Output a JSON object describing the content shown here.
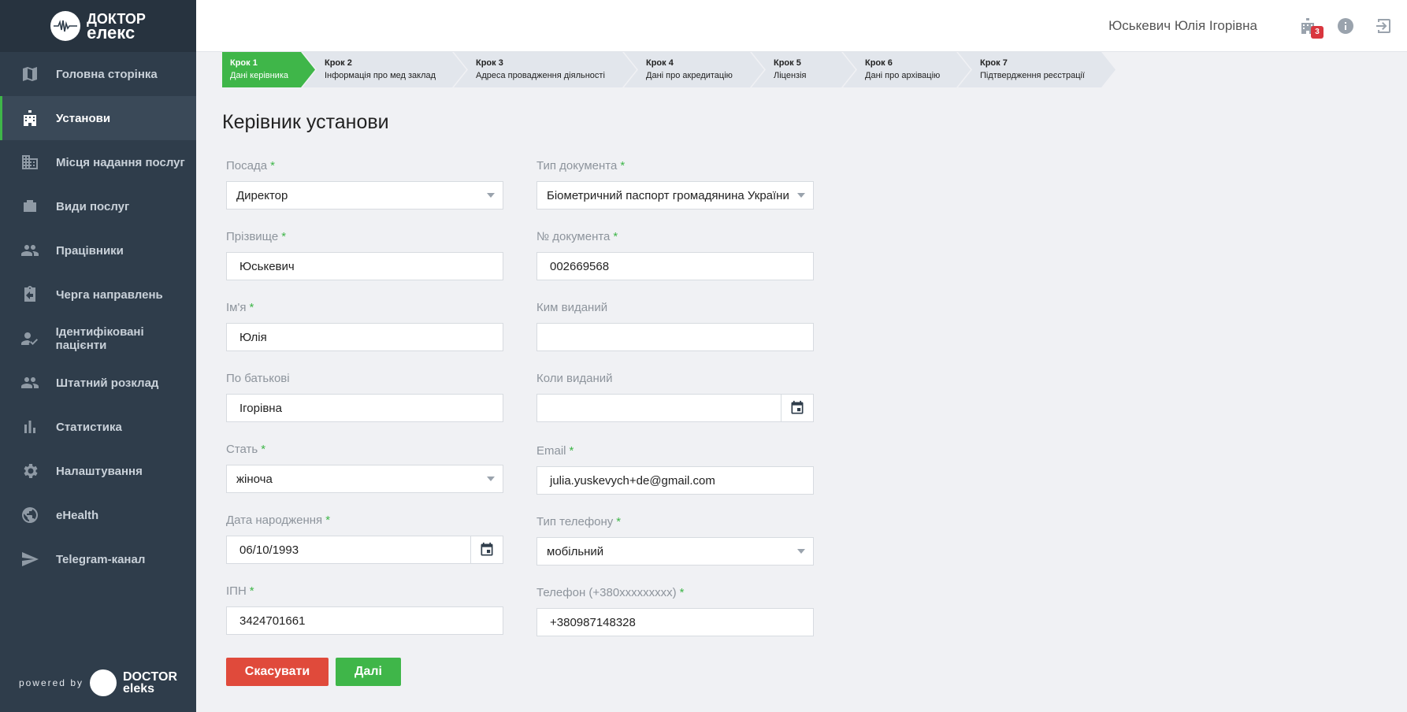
{
  "brand": {
    "logo_line1": "ДОКТОР",
    "logo_line2": "елекс",
    "powered_by": "powered by",
    "powered_line1": "DOCTOR",
    "powered_line2": "eleks"
  },
  "sidebar": {
    "items": [
      {
        "label": "Головна сторінка",
        "icon": "map-icon"
      },
      {
        "label": "Установи",
        "icon": "building-icon",
        "active": true
      },
      {
        "label": "Місця надання послуг",
        "icon": "office-building-icon"
      },
      {
        "label": "Види послуг",
        "icon": "briefcase-icon"
      },
      {
        "label": "Працівники",
        "icon": "people-icon"
      },
      {
        "label": "Черга направлень",
        "icon": "clipboard-icon"
      },
      {
        "label": "Ідентифіковані пацієнти",
        "icon": "person-check-icon"
      },
      {
        "label": "Штатний розклад",
        "icon": "people-icon"
      },
      {
        "label": "Статистика",
        "icon": "bar-chart-icon"
      },
      {
        "label": "Налаштування",
        "icon": "gear-icon"
      },
      {
        "label": "eHealth",
        "icon": "globe-icon"
      },
      {
        "label": "Telegram-канал",
        "icon": "send-icon"
      }
    ]
  },
  "header": {
    "user_name": "Юськевич Юлія Ігорівна",
    "notifications_count": "3"
  },
  "steps": [
    {
      "num": "Крок 1",
      "name": "Дані керівника",
      "active": true
    },
    {
      "num": "Крок 2",
      "name": "Інформація про мед заклад"
    },
    {
      "num": "Крок 3",
      "name": "Адреса провадження діяльності"
    },
    {
      "num": "Крок 4",
      "name": "Дані про акредитацію"
    },
    {
      "num": "Крок 5",
      "name": "Ліцензія"
    },
    {
      "num": "Крок 6",
      "name": "Дані про архівацію"
    },
    {
      "num": "Крок 7",
      "name": "Підтвердження реєстрації"
    }
  ],
  "form": {
    "title": "Керівник установи",
    "position": {
      "label": "Посада",
      "value": "Директор"
    },
    "last_name": {
      "label": "Прізвище",
      "value": "Юськевич"
    },
    "first_name": {
      "label": "Ім'я",
      "value": "Юлія"
    },
    "middle_name": {
      "label": "По батькові",
      "value": "Ігорівна"
    },
    "gender": {
      "label": "Стать",
      "value": "жіноча"
    },
    "birth_date": {
      "label": "Дата народження",
      "value": "06/10/1993"
    },
    "tax_id": {
      "label": "ІПН",
      "value": "3424701661"
    },
    "doc_type": {
      "label": "Тип документа",
      "value": "Біометричний паспорт громадянина України"
    },
    "doc_number": {
      "label": "№ документа",
      "value": "002669568"
    },
    "issued_by": {
      "label": "Ким виданий",
      "value": ""
    },
    "issued_date": {
      "label": "Коли виданий",
      "value": ""
    },
    "email": {
      "label": "Email",
      "value": "julia.yuskevych+de@gmail.com"
    },
    "phone_type": {
      "label": "Тип телефону",
      "value": "мобільний"
    },
    "phone": {
      "label": "Телефон (+380xxxxxxxxx)",
      "value": "+380987148328"
    },
    "required_mark": "*"
  },
  "buttons": {
    "cancel": "Скасувати",
    "next": "Далі"
  },
  "colors": {
    "accent": "#3fb649",
    "danger": "#e04a3b",
    "sidebar": "#2f3d4b"
  }
}
